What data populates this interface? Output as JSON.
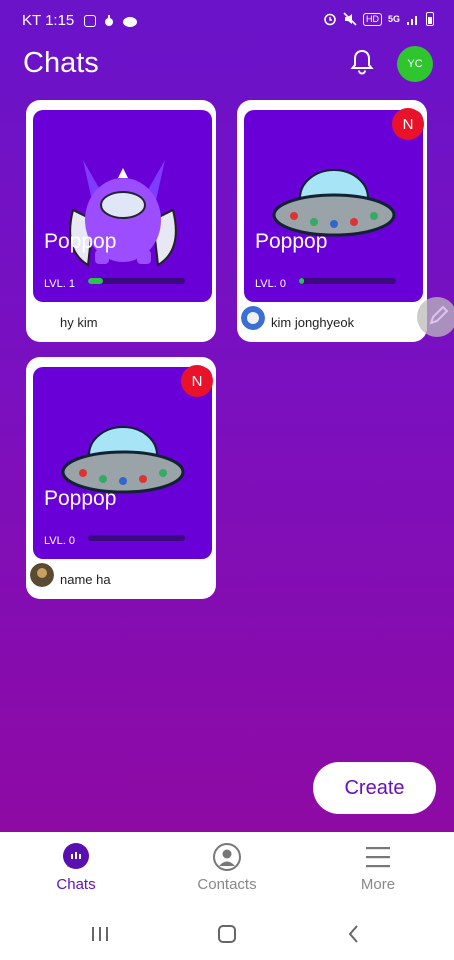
{
  "status_bar": {
    "carrier_time": "KT 1:15",
    "hd": "HD",
    "network": "5G"
  },
  "header": {
    "title": "Chats",
    "avatar_initials": "YC"
  },
  "cards": [
    {
      "name": "Poppop",
      "level": "LVL. 1",
      "owner": "hy kim",
      "new_badge": "",
      "xp": 0.15
    },
    {
      "name": "Poppop",
      "level": "LVL. 0",
      "owner": "kim jonghyeok",
      "new_badge": "N",
      "xp": 0.05
    },
    {
      "name": "Poppop",
      "level": "LVL. 0",
      "owner": "name ha",
      "new_badge": "N",
      "xp": 0.0
    }
  ],
  "create_button": "Create",
  "tabs": [
    {
      "label": "Chats",
      "icon": "chat-bubble-icon",
      "active": true
    },
    {
      "label": "Contacts",
      "icon": "person-icon",
      "active": false
    },
    {
      "label": "More",
      "icon": "menu-icon",
      "active": false
    }
  ],
  "colors": {
    "accent": "#6a0ec4",
    "card_art": "#6a00d8",
    "new_badge": "#e8132a",
    "xp_fill": "#29c44a",
    "avatar": "#2ec52e"
  }
}
